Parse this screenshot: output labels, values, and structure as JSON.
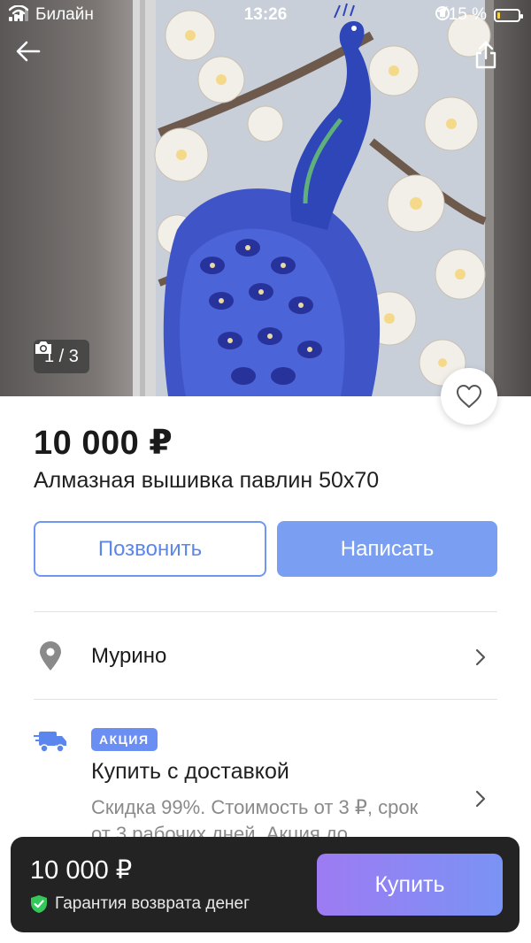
{
  "status_bar": {
    "carrier": "Билайн",
    "time": "13:26",
    "battery_text": "15 %",
    "battery_level": 0.15,
    "battery_color": "#f7d04a"
  },
  "gallery": {
    "current": "1 / 3",
    "icons": {
      "back": "back-arrow-icon",
      "share": "share-icon",
      "camera": "camera-icon",
      "favorite": "heart-icon"
    }
  },
  "listing": {
    "price": "10 000 ₽",
    "title": "Алмазная вышивка павлин 50х70"
  },
  "actions": {
    "call_label": "Позвонить",
    "write_label": "Написать"
  },
  "location": {
    "name": "Мурино",
    "icon": "location-pin-icon"
  },
  "delivery": {
    "badge": "АКЦИЯ",
    "title": "Купить с доставкой",
    "description": "Скидка 99%. Стоимость от 3 ₽, срок от 3 рабочих дней. Акция до",
    "icon": "delivery-truck-icon"
  },
  "bottom_bar": {
    "price": "10 000 ₽",
    "guarantee": "Гарантия возврата денег",
    "buy_label": "Купить"
  },
  "colors": {
    "accent": "#7a9ff2",
    "call_border": "#6f96f0",
    "badge": "#6a8ef2",
    "bottom_bar_bg": "#232323",
    "guarantee_icon": "#34c759"
  }
}
